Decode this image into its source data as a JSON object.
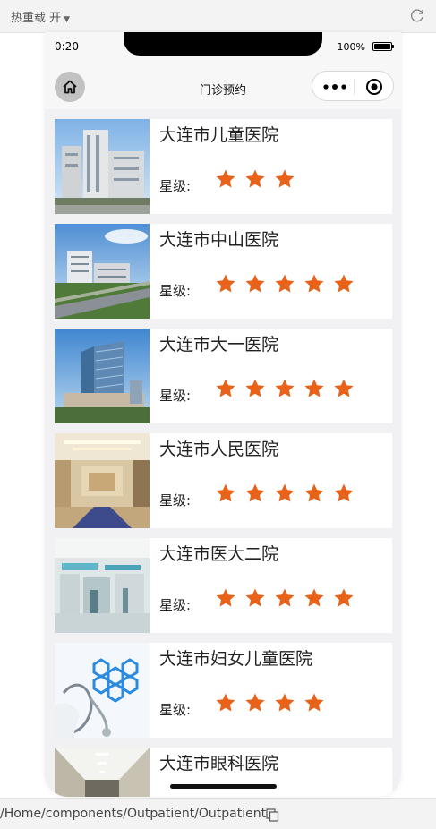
{
  "devtools": {
    "hot_reload_label": "热重载 开",
    "path": "/Home/components/Outpatient/Outpatient"
  },
  "status_bar": {
    "time": "0:20",
    "battery": "100%"
  },
  "nav": {
    "title": "门诊预约"
  },
  "rating_label": "星级:",
  "colors": {
    "star": "#e8621a",
    "card_bg": "#ffffff",
    "page_bg": "#f1f1f4"
  },
  "hospitals": [
    {
      "name": "大连市儿童医院",
      "stars": 3,
      "image": "hospital-building-photo"
    },
    {
      "name": "大连市中山医院",
      "stars": 5,
      "image": "hospital-campus-aerial-photo"
    },
    {
      "name": "大连市大一医院",
      "stars": 5,
      "image": "hospital-tower-photo"
    },
    {
      "name": "大连市人民医院",
      "stars": 5,
      "image": "hospital-lobby-photo"
    },
    {
      "name": "大连市医大二院",
      "stars": 5,
      "image": "hospital-hall-photo"
    },
    {
      "name": "大连市妇女儿童医院",
      "stars": 4,
      "image": "medical-stethoscope-photo"
    },
    {
      "name": "大连市眼科医院",
      "stars": 5,
      "image": "hospital-corridor-photo"
    }
  ]
}
